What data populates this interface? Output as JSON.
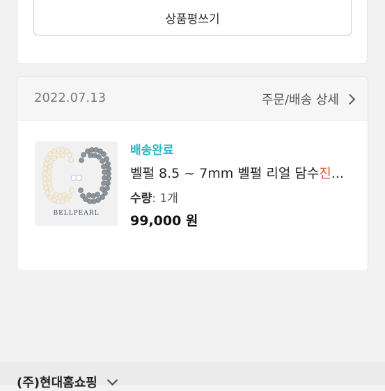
{
  "review": {
    "button_label": "상품평쓰기"
  },
  "order": {
    "date": "2022.07.13",
    "detail_link": "주문/배송 상세",
    "item": {
      "image_icon": "pearl-bracelet-image",
      "brand_on_image": "BELLPEARL",
      "status": "배송완료",
      "status_color": "#29b5c7",
      "name_prefix": "벨펄 8.5 ~ 7mm 벨펄 리얼 담수",
      "name_highlight": "진",
      "name_suffix": "...",
      "quantity_label": "수량",
      "quantity_value": ": 1개",
      "price": "99,000 원"
    }
  },
  "footer": {
    "company": "(주)현대홈쇼핑",
    "toggle_icon": "chevron-down-icon"
  }
}
